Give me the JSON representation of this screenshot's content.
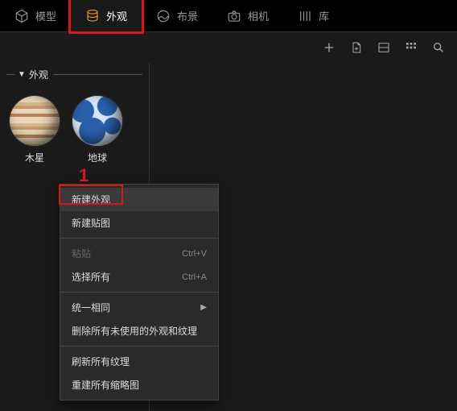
{
  "tabs": {
    "model": "模型",
    "appearance": "外观",
    "layout": "布景",
    "camera": "相机",
    "library": "库"
  },
  "panel": {
    "title": "外观"
  },
  "thumbs": {
    "jupiter": "木星",
    "earth": "地球"
  },
  "annotation": {
    "step1": "1"
  },
  "menu": {
    "new_appearance": "新建外观",
    "new_texture": "新建贴图",
    "paste": "粘贴",
    "paste_shortcut": "Ctrl+V",
    "select_all": "选择所有",
    "select_all_shortcut": "Ctrl+A",
    "unify_same": "统一相同",
    "delete_unused": "删除所有未使用的外观和纹理",
    "refresh_textures": "刷新所有纹理",
    "rebuild_thumbs": "重建所有缩略图"
  }
}
